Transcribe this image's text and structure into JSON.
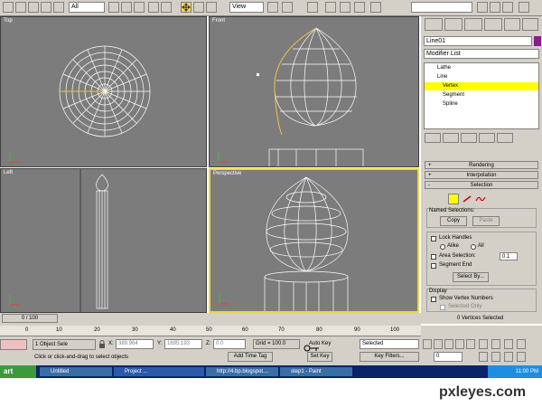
{
  "toolbar": {
    "selection_filter": "All",
    "coord_system": "View",
    "named_selection": ""
  },
  "viewports": {
    "top": {
      "label": "Top"
    },
    "front": {
      "label": "Front"
    },
    "left": {
      "label": "Left"
    },
    "perspective": {
      "label": "Perspective"
    }
  },
  "command_panel": {
    "object_name": "Line01",
    "modifier_list": "Modifier List",
    "stack": [
      "Lathe",
      "Line",
      "Vertex",
      "Segment",
      "Spline"
    ],
    "rollouts": {
      "rendering": "Rendering",
      "interpolation": "Interpolation",
      "selection": "Selection"
    },
    "named_selections_label": "Named Selections:",
    "copy": "Copy",
    "paste": "Paste",
    "lock_handles": "Lock Handles",
    "alike": "Alike",
    "all": "All",
    "area_selection": "Area Selection:",
    "area_value": "0.1",
    "segment_end": "Segment End",
    "select_by": "Select By...",
    "display_label": "Display",
    "show_vertex_numbers": "Show Vertex Numbers",
    "selected_only": "Selected Only",
    "status": "0 Vertices Selected",
    "accent_color": "#ffff00",
    "object_color": "#8a1d8a"
  },
  "timeline": {
    "frame": "0 / 100",
    "ticks": [
      "0",
      "10",
      "20",
      "30",
      "40",
      "50",
      "60",
      "70",
      "80",
      "90",
      "100"
    ]
  },
  "status_bar": {
    "object_select": "1 Object Sele",
    "x_label": "X:",
    "x_value": "389.964",
    "y_label": "Y:",
    "y_value": "1695.193",
    "z_label": "Z:",
    "z_value": "0.0",
    "grid": "Grid = 100.0",
    "auto_key": "Auto Key",
    "selected": "Selected",
    "set_key": "Set Key",
    "key_filters": "Key Filters...",
    "add_time_tag": "Add Time Tag",
    "prompt": "Click or click-and-drag to select objects",
    "frame_value": "0"
  },
  "taskbar": {
    "start": "art",
    "items": [
      "Untitled",
      "Project ...",
      "http://4.bp.blogspot....",
      "step1 - Paint"
    ],
    "clock": "11:00 PM"
  },
  "watermark": "pxleyes.com"
}
